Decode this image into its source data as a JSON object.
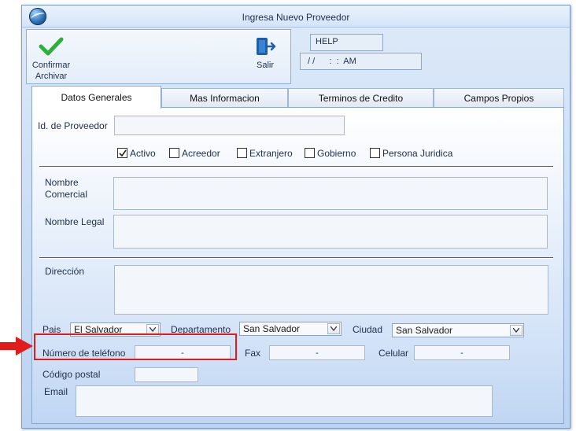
{
  "window": {
    "title": "Ingresa Nuevo Proveedor"
  },
  "toolbar": {
    "confirm_label": "Confirmar Archivar",
    "exit_label": "Salir"
  },
  "status": {
    "help": "HELP",
    "datetime": "/ /      :  :  AM"
  },
  "tabs": [
    {
      "label": "Datos Generales",
      "active": true
    },
    {
      "label": "Mas Informacion",
      "active": false
    },
    {
      "label": "Terminos de Credito",
      "active": false
    },
    {
      "label": "Campos Propios",
      "active": false
    }
  ],
  "form": {
    "id_label": "Id. de Proveedor",
    "id_value": "",
    "checkboxes": [
      {
        "label": "Activo",
        "checked": true
      },
      {
        "label": "Acreedor",
        "checked": false
      },
      {
        "label": "Extranjero",
        "checked": false
      },
      {
        "label": "Gobierno",
        "checked": false
      },
      {
        "label": "Persona Juridica",
        "checked": false
      }
    ],
    "nombre_comercial_label": "Nombre Comercial",
    "nombre_legal_label": "Nombre Legal",
    "direccion_label": "Dirección",
    "pais_label": "Pais",
    "pais_value": "El Salvador",
    "departamento_label": "Departamento",
    "departamento_value": "San Salvador",
    "ciudad_label": "Ciudad",
    "ciudad_value": "San Salvador",
    "telefono_label": "Número de teléfono",
    "telefono_value": "-",
    "fax_label": "Fax",
    "fax_value": "-",
    "celular_label": "Celular",
    "celular_value": "-",
    "postal_label": "Código postal",
    "postal_value": "",
    "email_label": "Email",
    "email_value": ""
  },
  "colors": {
    "highlight": "#e21c1c",
    "confirm_icon": "#2fae3a",
    "exit_icon": "#1f5fa8"
  },
  "icons": {
    "app": "globe-logo-icon",
    "confirm": "checkmark-icon",
    "exit": "exit-door-icon",
    "annotation": "red-arrow-icon"
  }
}
